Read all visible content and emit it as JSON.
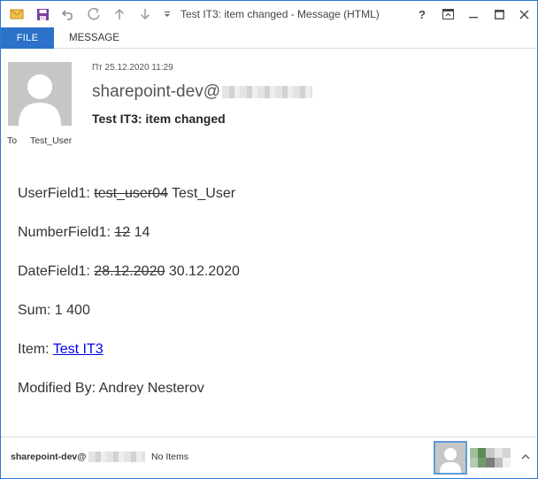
{
  "window": {
    "title": "Test IT3: item changed - Message (HTML)",
    "controls": {
      "help": "?",
      "restore_ribbon": "⊡",
      "minimize": "—",
      "maximize": "☐",
      "close": "✕"
    }
  },
  "quick_access": [
    "envelope-icon",
    "save-icon",
    "undo-icon",
    "redo-icon",
    "arrow-up-icon",
    "arrow-down-icon",
    "customize-qat-icon"
  ],
  "ribbon": {
    "tab_file": "FILE",
    "tab_message": "MESSAGE"
  },
  "header": {
    "date": "Пт 25.12.2020 11:29",
    "sender": "sharepoint-dev@",
    "subject": "Test IT3: item changed",
    "to_label": "To",
    "to_value": "Test_User"
  },
  "body": {
    "user_field": {
      "label": "UserField1:",
      "old": "test_user04",
      "new": "Test_User"
    },
    "number_field": {
      "label": "NumberField1:",
      "old": "12",
      "new": "14"
    },
    "date_field": {
      "label": "DateField1:",
      "old": "28.12.2020",
      "new": "30.12.2020"
    },
    "sum": {
      "label": "Sum:",
      "value": "1 400"
    },
    "item": {
      "label": "Item:",
      "link": "Test IT3"
    },
    "modified_by": {
      "label": "Modified By:",
      "value": "Andrey Nesterov"
    }
  },
  "footer": {
    "sender": "sharepoint-dev@",
    "no_items": "No Items"
  },
  "colors": {
    "accent": "#2b72c8",
    "link": "#0000ee",
    "border": "#2b7bd3"
  }
}
